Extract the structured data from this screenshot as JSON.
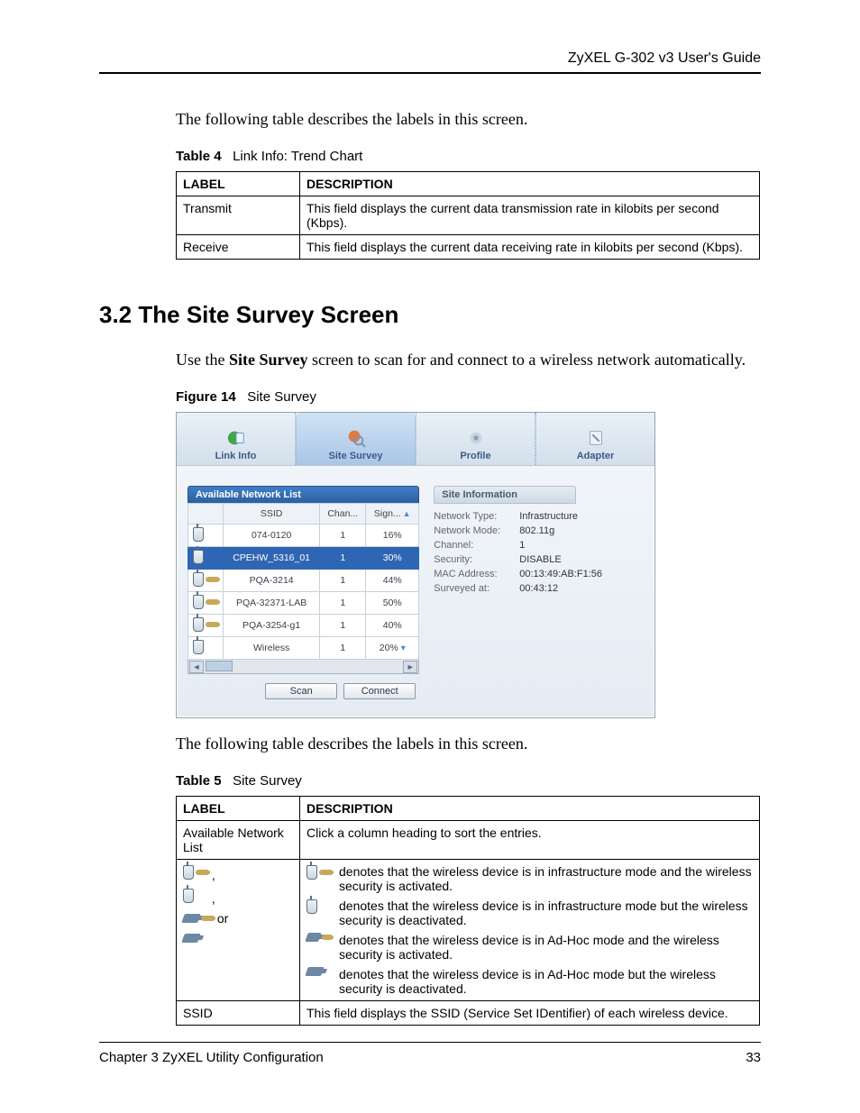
{
  "header": {
    "guide_title": "ZyXEL G-302 v3 User's Guide"
  },
  "intro_text_1": "The following table describes the labels in this screen.",
  "table4": {
    "caption_prefix": "Table 4",
    "caption_title": "Link Info: Trend Chart",
    "head_label": "LABEL",
    "head_desc": "DESCRIPTION",
    "rows": [
      {
        "label": "Transmit",
        "desc": "This field displays the current data transmission rate in kilobits per second (Kbps)."
      },
      {
        "label": "Receive",
        "desc": "This field displays the current data receiving rate in kilobits per second (Kbps)."
      }
    ]
  },
  "section_heading": "3.2  The Site Survey Screen",
  "section_intro_pre": "Use the ",
  "section_intro_bold": "Site Survey",
  "section_intro_post": " screen to scan for and connect to a wireless network automatically.",
  "figure14": {
    "caption_prefix": "Figure 14",
    "caption_title": "Site Survey"
  },
  "site_survey": {
    "tabs": {
      "link_info": "Link Info",
      "site_survey": "Site Survey",
      "profile": "Profile",
      "adapter": "Adapter"
    },
    "left_panel_title": "Available Network List",
    "columns": {
      "ssid": "SSID",
      "channel": "Chan...",
      "signal": "Sign..."
    },
    "networks": [
      {
        "ssid": "074-0120",
        "channel": "1",
        "signal": "16%",
        "secured": false,
        "selected": false
      },
      {
        "ssid": "CPEHW_5316_01",
        "channel": "1",
        "signal": "30%",
        "secured": false,
        "selected": true
      },
      {
        "ssid": "PQA-3214",
        "channel": "1",
        "signal": "44%",
        "secured": true,
        "selected": false
      },
      {
        "ssid": "PQA-32371-LAB",
        "channel": "1",
        "signal": "50%",
        "secured": true,
        "selected": false
      },
      {
        "ssid": "PQA-3254-g1",
        "channel": "1",
        "signal": "40%",
        "secured": true,
        "selected": false
      },
      {
        "ssid": "Wireless",
        "channel": "1",
        "signal": "20%",
        "secured": false,
        "selected": false
      }
    ],
    "buttons": {
      "scan": "Scan",
      "connect": "Connect"
    },
    "right_panel_title": "Site Information",
    "info": {
      "network_type_k": "Network Type:",
      "network_type_v": "Infrastructure",
      "network_mode_k": "Network Mode:",
      "network_mode_v": "802.11g",
      "channel_k": "Channel:",
      "channel_v": "1",
      "security_k": "Security:",
      "security_v": "DISABLE",
      "mac_k": "MAC Address:",
      "mac_v": "00:13:49:AB:F1:56",
      "surveyed_k": "Surveyed at:",
      "surveyed_v": "00:43:12"
    }
  },
  "intro_text_2": "The following table describes the labels in this screen.",
  "table5": {
    "caption_prefix": "Table 5",
    "caption_title": "Site Survey",
    "head_label": "LABEL",
    "head_desc": "DESCRIPTION",
    "row1_label": "Available Network List",
    "row1_desc": "Click a column heading to sort the entries.",
    "row2_label_sep1": " ,",
    "row2_label_sep2": " ,",
    "row2_label_sep3": " or",
    "icon_desc_1": "denotes that the wireless device is in infrastructure mode and the wireless security is activated.",
    "icon_desc_2": "denotes that the wireless device is in infrastructure mode but the wireless security is deactivated.",
    "icon_desc_3": "denotes that the wireless device is in Ad-Hoc mode and the wireless security is activated.",
    "icon_desc_4": "denotes that the wireless device is in Ad-Hoc mode but the wireless security is deactivated.",
    "row3_label": "SSID",
    "row3_desc": "This field displays the SSID (Service Set IDentifier) of each wireless device."
  },
  "footer": {
    "chapter": "Chapter 3 ZyXEL Utility Configuration",
    "page": "33"
  }
}
